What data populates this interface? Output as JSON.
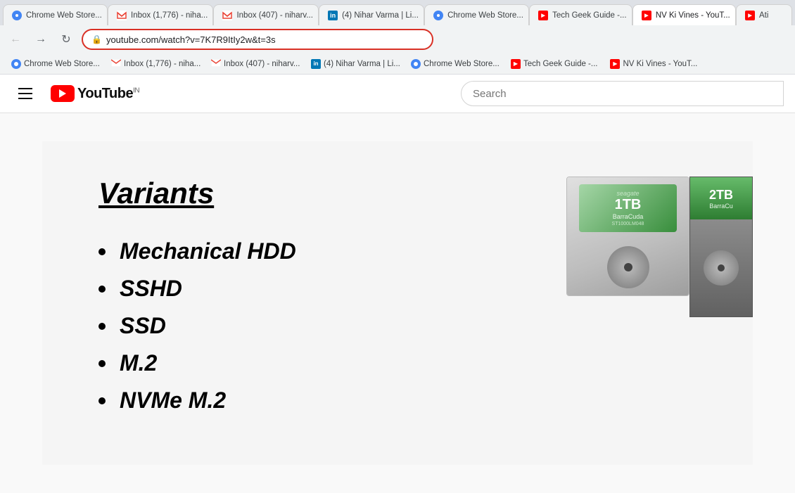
{
  "browser": {
    "back_btn": "←",
    "forward_btn": "→",
    "reload_btn": "↻",
    "address": "youtube.com/watch?v=7K7R9ItIy2w&t=3s",
    "tabs": [
      {
        "id": "tab1",
        "label": "Chrome Web Store...",
        "favicon_type": "chrome",
        "active": false
      },
      {
        "id": "tab2",
        "label": "Inbox (1,776) - niha...",
        "favicon_type": "gmail",
        "active": false
      },
      {
        "id": "tab3",
        "label": "Inbox (407) - niharv...",
        "favicon_type": "gmail",
        "active": false
      },
      {
        "id": "tab4",
        "label": "(4) Nihar Varma | Li...",
        "favicon_type": "linkedin",
        "active": false
      },
      {
        "id": "tab5",
        "label": "Chrome Web Store...",
        "favicon_type": "chrome",
        "active": false
      },
      {
        "id": "tab6",
        "label": "Tech Geek Guide -...",
        "favicon_type": "youtube",
        "active": false
      },
      {
        "id": "tab7",
        "label": "NV Ki Vines - YouT...",
        "favicon_type": "youtube",
        "active": true
      },
      {
        "id": "tab8",
        "label": "Ati",
        "favicon_type": "youtube",
        "active": false
      }
    ]
  },
  "bookmarks": [
    {
      "id": "bm1",
      "label": "Chrome Web Store...",
      "favicon_type": "chrome"
    },
    {
      "id": "bm2",
      "label": "Inbox (1,776) - niha...",
      "favicon_type": "gmail"
    },
    {
      "id": "bm3",
      "label": "Inbox (407) - niharv...",
      "favicon_type": "gmail"
    },
    {
      "id": "bm4",
      "label": "(4) Nihar Varma | Li...",
      "favicon_type": "linkedin"
    },
    {
      "id": "bm5",
      "label": "Chrome Web Store...",
      "favicon_type": "chrome"
    },
    {
      "id": "bm6",
      "label": "Tech Geek Guide -...",
      "favicon_type": "youtube"
    },
    {
      "id": "bm7",
      "label": "NV Ki Vines - YouT...",
      "favicon_type": "youtube"
    }
  ],
  "youtube": {
    "logo_text": "YouTube",
    "country_code": "IN",
    "search_placeholder": "Search",
    "slide": {
      "title": "Variants",
      "bullets": [
        "Mechanical HDD",
        "SSHD",
        "SSD",
        "M.2",
        "NVMe M.2"
      ]
    },
    "hdd1": {
      "brand": "seagate",
      "capacity": "1TB",
      "model": "BarraCuda",
      "model_num": "ST1000LM048"
    },
    "hdd2": {
      "capacity": "2TB",
      "model": "BarraCu"
    }
  }
}
